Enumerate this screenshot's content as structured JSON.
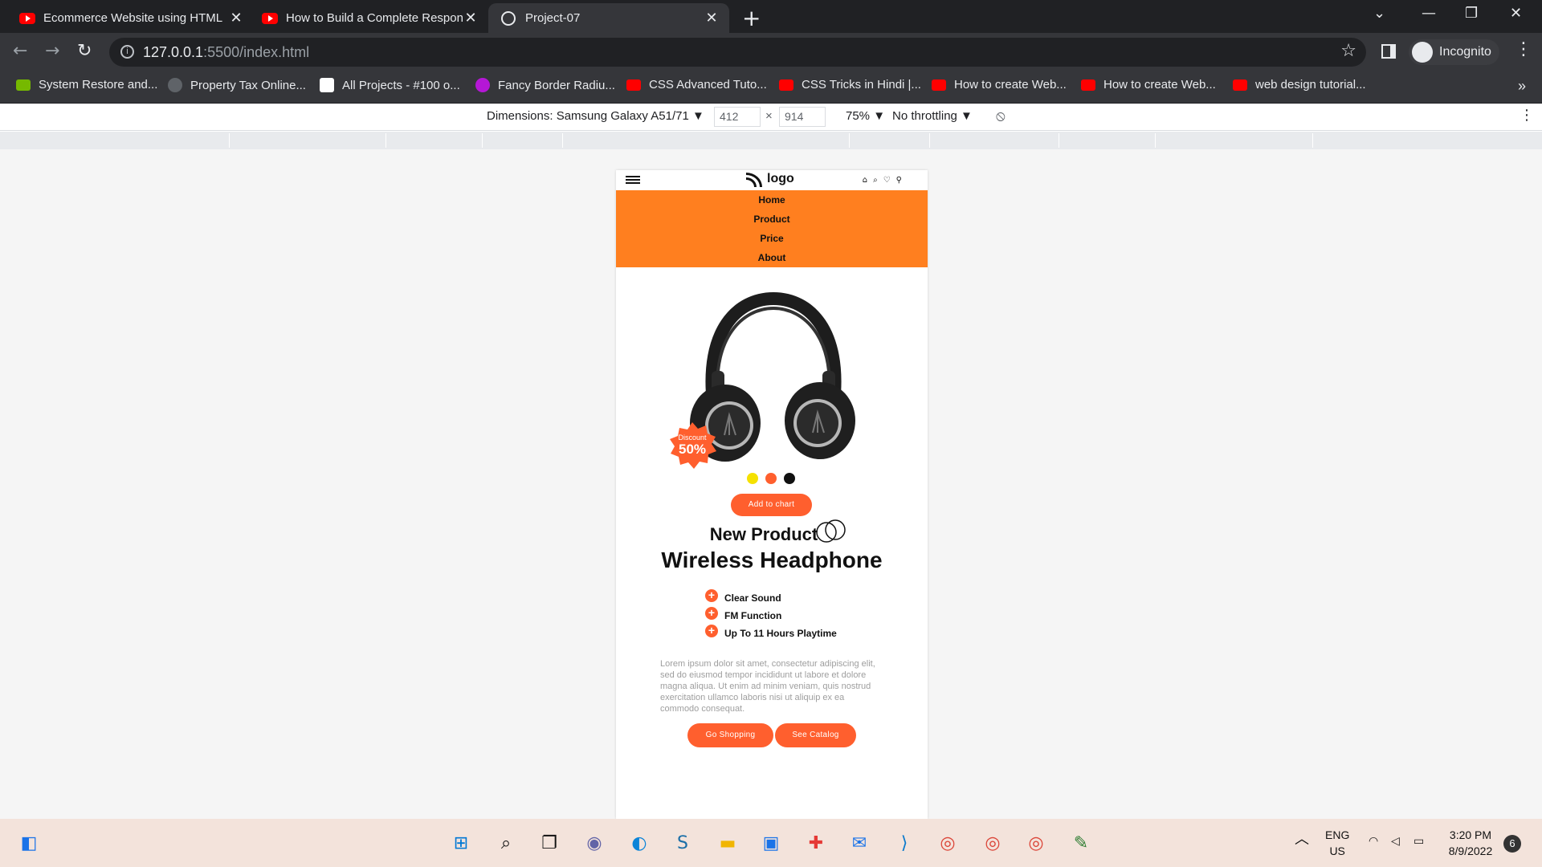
{
  "browser": {
    "tabs": [
      {
        "title": "Ecommerce Website using HTML",
        "icon": "youtube-icon"
      },
      {
        "title": "How to Build a Complete Respon",
        "icon": "youtube-icon"
      },
      {
        "title": "Project-07",
        "icon": "globe-icon"
      }
    ],
    "url_host": "127.0.0.1",
    "url_path": ":5500/index.html",
    "profile_label": "Incognito"
  },
  "bookmarks": [
    "System Restore and...",
    "Property Tax Online...",
    "All Projects - #100 o...",
    "Fancy Border Radiu...",
    "CSS Advanced Tuto...",
    "CSS Tricks in Hindi |...",
    "How to create Web...",
    "How to create Web...",
    "web design tutorial..."
  ],
  "devtools": {
    "dimensions_label": "Dimensions: Samsung Galaxy A51/71 ▼",
    "width": "412",
    "height": "914",
    "times": "×",
    "zoom": "75% ▼",
    "throttling": "No throttling ▼"
  },
  "page": {
    "logo_text": "logo",
    "nav": [
      "Home",
      "Product",
      "Price",
      "About"
    ],
    "badge_label": "Discount",
    "badge_value": "50%",
    "color_swatches": [
      "#f5e100",
      "#ff5f2e",
      "#111111"
    ],
    "accent_color": "#ff5f2e",
    "nav_color": "#ff7f1f",
    "add_to_cart": "Add to chart",
    "subtitle": "New Product",
    "title": "Wireless Headphone",
    "features": [
      "Clear Sound",
      "FM Function",
      "Up To 11 Hours Playtime"
    ],
    "description": "Lorem ipsum dolor sit amet, consectetur adipiscing elit, sed do eiusmod tempor incididunt ut labore et dolore magna aliqua. Ut enim ad minim veniam, quis nostrud exercitation ullamco laboris nisi ut aliquip ex ea commodo consequat.",
    "go_shopping": "Go Shopping",
    "see_catalog": "See Catalog"
  },
  "taskbar": {
    "lang_line1": "ENG",
    "lang_line2": "US",
    "time": "3:20 PM",
    "date": "8/9/2022",
    "notifications": "6"
  }
}
